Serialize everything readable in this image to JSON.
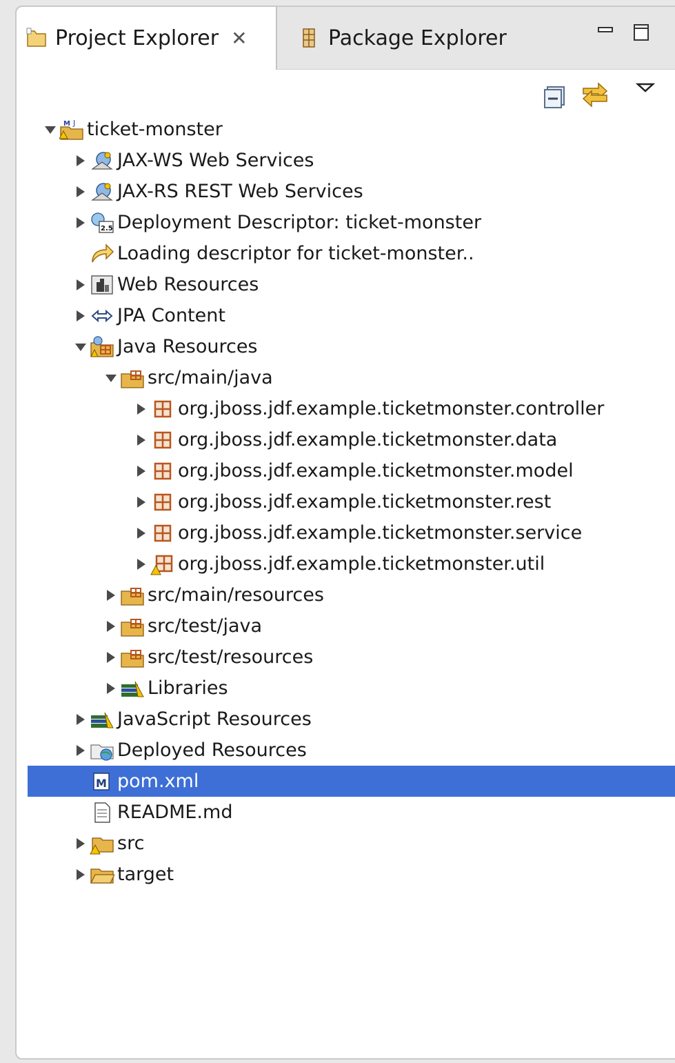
{
  "tabs": [
    {
      "label": "Project Explorer",
      "close_glyph": "✕",
      "icon": "project-explorer-icon"
    },
    {
      "label": "Package Explorer",
      "icon": "package-explorer-icon"
    }
  ],
  "window_controls": {
    "minimize": "minimize-icon",
    "maximize": "maximize-icon"
  },
  "toolbar": {
    "collapse_all": "collapse-all-icon",
    "link_with_editor": "link-with-editor-icon",
    "view_menu": "view-menu-icon"
  },
  "tree": [
    {
      "label": "ticket-monster",
      "depth": 0,
      "expanded": true,
      "icon": "maven-project-icon"
    },
    {
      "label": "JAX-WS Web Services",
      "depth": 1,
      "expanded": false,
      "icon": "web-services-icon"
    },
    {
      "label": "JAX-RS REST Web Services",
      "depth": 1,
      "expanded": false,
      "icon": "web-services-icon"
    },
    {
      "label": "Deployment Descriptor: ticket-monster",
      "depth": 1,
      "expanded": false,
      "icon": "deployment-descriptor-icon"
    },
    {
      "label": "Loading descriptor for ticket-monster..",
      "depth": 1,
      "leaf": true,
      "icon": "loading-arrow-icon"
    },
    {
      "label": "Web Resources",
      "depth": 1,
      "expanded": false,
      "icon": "web-resources-icon"
    },
    {
      "label": "JPA Content",
      "depth": 1,
      "expanded": false,
      "icon": "jpa-icon"
    },
    {
      "label": "Java Resources",
      "depth": 1,
      "expanded": true,
      "icon": "java-resources-icon"
    },
    {
      "label": "src/main/java",
      "depth": 2,
      "expanded": true,
      "icon": "source-folder-icon"
    },
    {
      "label": "org.jboss.jdf.example.ticketmonster.controller",
      "depth": 3,
      "expanded": false,
      "icon": "package-icon"
    },
    {
      "label": "org.jboss.jdf.example.ticketmonster.data",
      "depth": 3,
      "expanded": false,
      "icon": "package-icon"
    },
    {
      "label": "org.jboss.jdf.example.ticketmonster.model",
      "depth": 3,
      "expanded": false,
      "icon": "package-icon"
    },
    {
      "label": "org.jboss.jdf.example.ticketmonster.rest",
      "depth": 3,
      "expanded": false,
      "icon": "package-icon"
    },
    {
      "label": "org.jboss.jdf.example.ticketmonster.service",
      "depth": 3,
      "expanded": false,
      "icon": "package-icon"
    },
    {
      "label": "org.jboss.jdf.example.ticketmonster.util",
      "depth": 3,
      "expanded": false,
      "icon": "package-warning-icon"
    },
    {
      "label": "src/main/resources",
      "depth": 2,
      "expanded": false,
      "icon": "source-folder-icon"
    },
    {
      "label": "src/test/java",
      "depth": 2,
      "expanded": false,
      "icon": "source-folder-icon"
    },
    {
      "label": "src/test/resources",
      "depth": 2,
      "expanded": false,
      "icon": "source-folder-icon"
    },
    {
      "label": "Libraries",
      "depth": 2,
      "expanded": false,
      "icon": "libraries-icon"
    },
    {
      "label": "JavaScript Resources",
      "depth": 1,
      "expanded": false,
      "icon": "libraries-icon"
    },
    {
      "label": "Deployed Resources",
      "depth": 1,
      "expanded": false,
      "icon": "deployed-resources-icon"
    },
    {
      "label": "pom.xml",
      "depth": 1,
      "leaf": true,
      "selected": true,
      "icon": "maven-pom-icon"
    },
    {
      "label": "README.md",
      "depth": 1,
      "leaf": true,
      "icon": "text-file-icon"
    },
    {
      "label": "src",
      "depth": 1,
      "expanded": false,
      "icon": "folder-warning-icon"
    },
    {
      "label": "target",
      "depth": 1,
      "expanded": false,
      "icon": "folder-icon"
    }
  ],
  "colors": {
    "selection": "#3d6fd6",
    "package": "#b8561e",
    "folder": "#e7b64a"
  }
}
